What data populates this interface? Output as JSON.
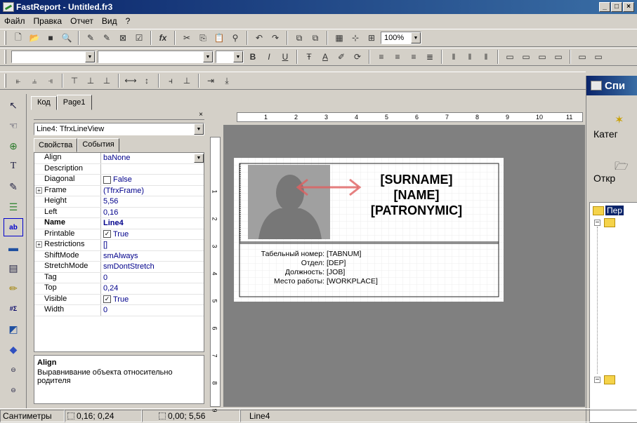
{
  "window": {
    "title": "FastReport - Untitled.fr3",
    "buttons": [
      "_",
      "□",
      "×"
    ]
  },
  "menu": [
    "Файл",
    "Правка",
    "Отчет",
    "Вид",
    "?"
  ],
  "toolbar1": {
    "zoom": "100%"
  },
  "tabs": [
    "Код",
    "Page1"
  ],
  "inspector": {
    "object": "Line4: TfrxLineView",
    "subtabs": [
      "Свойства",
      "События"
    ],
    "props": [
      {
        "name": "Align",
        "value": "baNone",
        "dropdown": true
      },
      {
        "name": "Description",
        "value": ""
      },
      {
        "name": "Diagonal",
        "value": "False",
        "check": false
      },
      {
        "name": "Frame",
        "value": "(TfrxFrame)",
        "expand": true
      },
      {
        "name": "Height",
        "value": "5,56"
      },
      {
        "name": "Left",
        "value": "0,16"
      },
      {
        "name": "Name",
        "value": "Line4",
        "bold": true
      },
      {
        "name": "Printable",
        "value": "True",
        "check": true
      },
      {
        "name": "Restrictions",
        "value": "[]",
        "expand": true
      },
      {
        "name": "ShiftMode",
        "value": "smAlways"
      },
      {
        "name": "StretchMode",
        "value": "smDontStretch"
      },
      {
        "name": "Tag",
        "value": "0"
      },
      {
        "name": "Top",
        "value": "0,24"
      },
      {
        "name": "Visible",
        "value": "True",
        "check": true
      },
      {
        "name": "Width",
        "value": "0"
      }
    ],
    "help_title": "Align",
    "help_text": "Выравнивание объекта относительно родителя"
  },
  "ruler": [
    "1",
    "2",
    "3",
    "4",
    "5",
    "6",
    "7",
    "8",
    "9",
    "10",
    "11"
  ],
  "vruler": [
    "1",
    "2",
    "3",
    "4",
    "5",
    "6",
    "7",
    "8",
    "9"
  ],
  "report": {
    "surname": "[SURNAME]",
    "name": "[NAME]",
    "patronymic": "[PATRONYMIC]",
    "fields": [
      {
        "label": "Табельный номер:",
        "value": "[TABNUM]"
      },
      {
        "label": "Отдел:",
        "value": "[DEP]"
      },
      {
        "label": "Должность:",
        "value": "[JOB]"
      },
      {
        "label": "Место работы:",
        "value": "[WORKPLACE]"
      }
    ]
  },
  "rightpanel": {
    "title": "Спи",
    "item1": "Катег",
    "item2": "Откр",
    "tree_item": "Пер"
  },
  "status": {
    "units": "Сантиметры",
    "pos": "0,16; 0,24",
    "size": "0,00; 5,56",
    "object": "Line4"
  },
  "colors": {
    "title_start": "#0a246a",
    "title_end": "#3a6ea5",
    "workspace": "#808080",
    "arrow": "#e06060"
  }
}
